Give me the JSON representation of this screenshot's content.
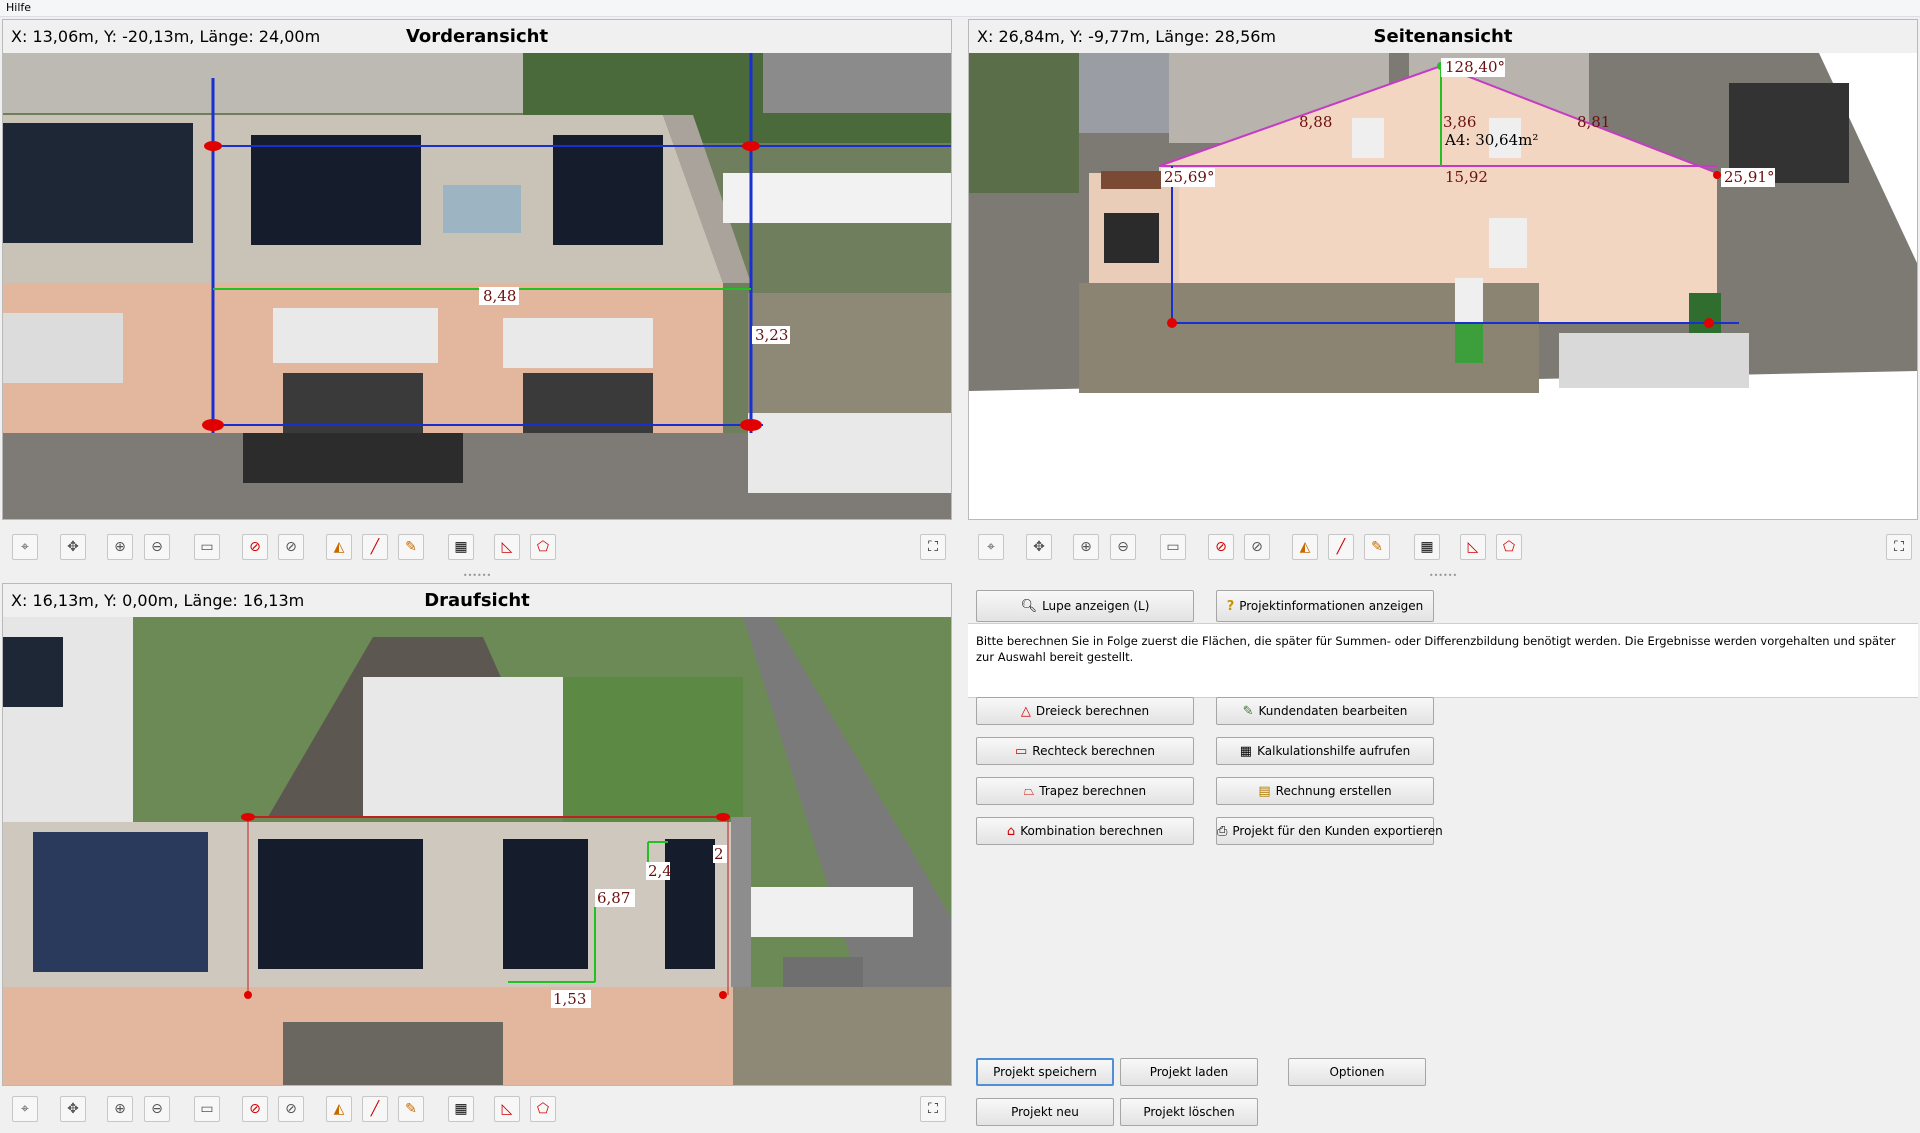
{
  "menu": {
    "help": "Hilfe"
  },
  "views": {
    "front": {
      "title": "Vorderansicht",
      "coords": "X: 13,06m, Y: -20,13m, Länge: 24,00m",
      "labels": [
        "8,48",
        "3,23"
      ]
    },
    "side": {
      "title": "Seitenansicht",
      "coords": "X: 26,84m, Y: -9,77m, Länge: 28,56m",
      "labels": [
        "128,40°",
        "8,88",
        "3,86",
        "8,81",
        "A4: 30,64m²",
        "25,69°",
        "15,92",
        "25,91°"
      ]
    },
    "top": {
      "title": "Draufsicht",
      "coords": "X: 16,13m, Y: 0,00m, Länge: 16,13m",
      "labels": [
        "2,4",
        "6,87",
        "1,53",
        "2"
      ]
    }
  },
  "toolbar_icons": [
    "target-icon",
    "move-icon",
    "zoom-in-icon",
    "zoom-out-icon",
    "rectangle-select-icon",
    "stop-icon",
    "cancel-icon",
    "measure-icon",
    "line-icon",
    "pen-icon",
    "grid-icon",
    "angle-icon",
    "polygon-icon",
    "fullscreen-icon"
  ],
  "buttons": {
    "magnifier": "Lupe anzeigen (L)",
    "project_info": "Projektinformationen anzeigen",
    "triangle": "Dreieck berechnen",
    "rectangle": "Rechteck berechnen",
    "trapezoid": "Trapez berechnen",
    "combination": "Kombination berechnen",
    "customer_data": "Kundendaten bearbeiten",
    "calc_help": "Kalkulationshilfe aufrufen",
    "invoice": "Rechnung erstellen",
    "export": "Projekt für den Kunden exportieren",
    "save": "Projekt speichern",
    "load": "Projekt laden",
    "options": "Optionen",
    "new": "Projekt neu",
    "delete": "Projekt löschen"
  },
  "info_text": "Bitte berechnen Sie in Folge zuerst die Flächen, die später für Summen- oder Differenzbildung benötigt werden. Die Ergebnisse werden vorgehalten und später zur Auswahl bereit gestellt.",
  "colors": {
    "measure_blue": "#1a2fd0",
    "marker_red": "#e00000",
    "marker_green": "#22c022",
    "side_purple": "#c43cc4"
  }
}
